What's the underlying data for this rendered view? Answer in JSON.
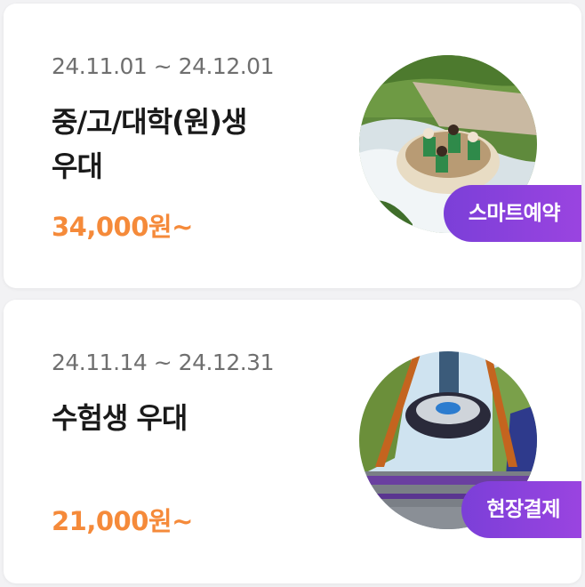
{
  "offers": [
    {
      "period": "24.11.01 ~ 24.12.01",
      "title_line1": "중/고/대학(원)생",
      "title_line2": "우대",
      "price": "34,000원~",
      "badge": "스마트예약",
      "image": "river-rafting-ride-photo"
    },
    {
      "period": "24.11.14 ~ 24.12.31",
      "title_line1": "수험생 우대",
      "title_line2": "",
      "price": "21,000원~",
      "badge": "현장결제",
      "image": "pendulum-swing-ride-photo"
    }
  ],
  "colors": {
    "price": "#f58a3a",
    "badge_start": "#7b3fd8",
    "badge_end": "#9a44e0",
    "date": "#6f6f6f"
  }
}
